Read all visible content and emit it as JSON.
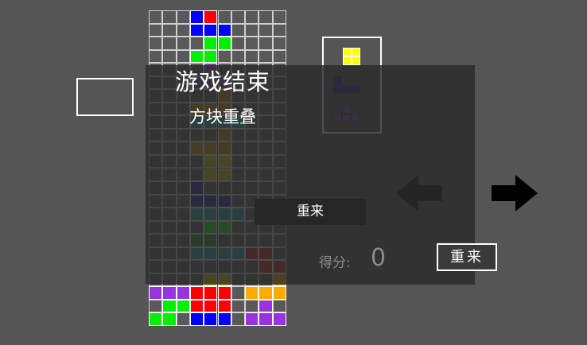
{
  "game_over": {
    "heading": "游戏结束",
    "reason": "方块重叠",
    "retry_inner_label": "重来"
  },
  "score": {
    "label": "得分:",
    "value": "0"
  },
  "retry_button_label": "重来",
  "colors": {
    "background": "#555555",
    "board": "#595959",
    "grid_line": "#cfcfcf",
    "overlay": "rgba(44,44,44,0.84)",
    "arrow": "#000000"
  },
  "board": {
    "cols": 10,
    "rows": 23,
    "legend": {
      "B": "#0000ff",
      "R": "#ff0000",
      "G": "#00ee00",
      "P": "#9933dd",
      "U": "#7744aa",
      "O": "#cc8800",
      "Y": "#cccc00",
      "T": "#22aaaa",
      "N": "#1a1aaa",
      "D": "#228822",
      "M": "#cc2222",
      "A": "#ffaa00"
    },
    "cells": [
      "...BR.....",
      "...BBB....",
      "....GG....",
      "...GG.....",
      "....U.....",
      "...UUU....",
      ".....O....",
      "...OOO....",
      "...TTTT...",
      ".....O....",
      "...OOO....",
      "....YY....",
      "....YY....",
      "...N......",
      "...NNN....",
      "...TTTT...",
      "....GG....",
      "...DD.....",
      "...TTTTMM.",
      "........MM",
      "....YY...A",
      "PPPRRR.AAA",
      ".GGRRR..P.",
      "GG.BBB.PPP"
    ]
  },
  "next_queue": [
    {
      "icon": "o-piece-icon",
      "color": "#ffff00",
      "cells": [
        [
          0,
          0
        ],
        [
          1,
          0
        ],
        [
          0,
          1
        ],
        [
          1,
          1
        ]
      ]
    },
    {
      "icon": "j-piece-icon",
      "color": "#1a1aaa",
      "cells": [
        [
          0,
          0
        ],
        [
          0,
          1
        ],
        [
          1,
          1
        ],
        [
          2,
          1
        ]
      ]
    },
    {
      "icon": "t-piece-icon",
      "color": "#7744aa",
      "cells": [
        [
          1,
          0
        ],
        [
          0,
          1
        ],
        [
          1,
          1
        ],
        [
          2,
          1
        ]
      ]
    }
  ]
}
